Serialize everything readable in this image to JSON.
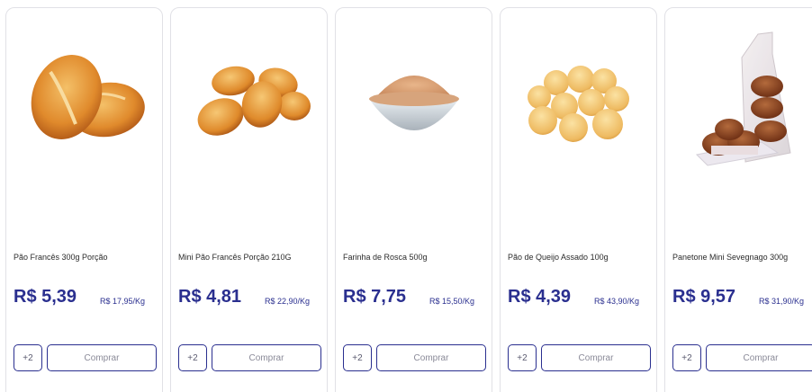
{
  "products": [
    {
      "name": "Pão Francês 300g Porção",
      "price": "R$ 5,39",
      "unit_price": "R$ 17,95/Kg",
      "options_label": "+2",
      "buy_label": "Comprar",
      "image_icon": "french-bread-icon"
    },
    {
      "name": "Mini Pão Francês Porção 210G",
      "price": "R$ 4,81",
      "unit_price": "R$ 22,90/Kg",
      "options_label": "+2",
      "buy_label": "Comprar",
      "image_icon": "mini-bread-icon"
    },
    {
      "name": "Farinha de Rosca 500g",
      "price": "R$ 7,75",
      "unit_price": "R$ 15,50/Kg",
      "options_label": "+2",
      "buy_label": "Comprar",
      "image_icon": "breadcrumb-bowl-icon"
    },
    {
      "name": "Pão de Queijo Assado 100g",
      "price": "R$ 4,39",
      "unit_price": "R$ 43,90/Kg",
      "options_label": "+2",
      "buy_label": "Comprar",
      "image_icon": "cheese-bread-icon"
    },
    {
      "name": "Panetone Mini Sevegnago 300g",
      "price": "R$ 9,57",
      "unit_price": "R$ 31,90/Kg",
      "options_label": "+2",
      "buy_label": "Comprar",
      "image_icon": "mini-panettone-icon"
    }
  ],
  "colors": {
    "accent": "#2a2f8f",
    "card_border": "#e1e1e6",
    "muted_text": "#8a8a98"
  }
}
